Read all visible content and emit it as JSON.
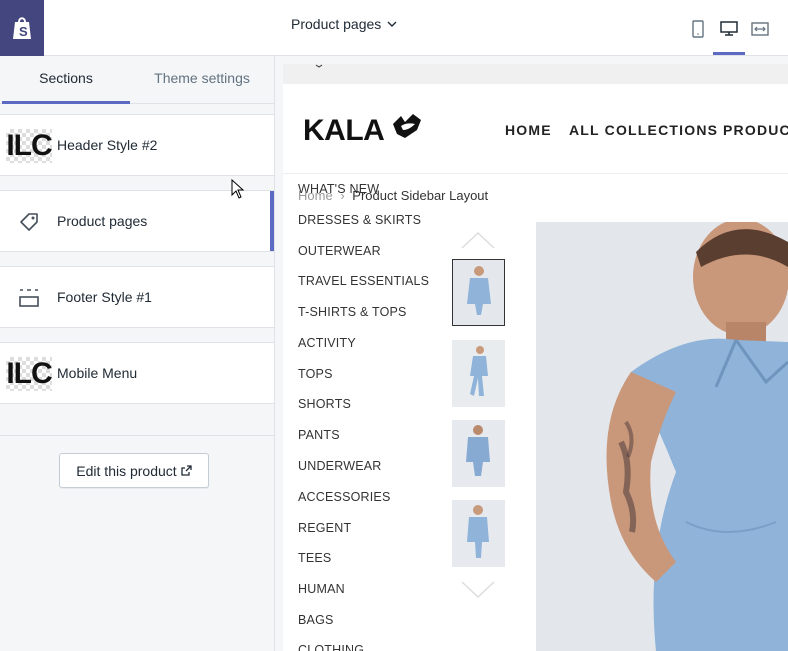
{
  "editor": {
    "tabs": [
      {
        "label": "Sections",
        "active": true
      },
      {
        "label": "Theme settings",
        "active": false
      }
    ],
    "sections": [
      {
        "label": "Header Style #2",
        "icon": "ilc-thumbnail"
      },
      {
        "label": "Product pages",
        "icon": "tag-icon",
        "selected": true
      },
      {
        "label": "Footer Style #1",
        "icon": "footer-layout-icon"
      },
      {
        "label": "Mobile Menu",
        "icon": "ilc-thumbnail"
      }
    ],
    "thumb_text": "ILC",
    "edit_button": "Edit this product"
  },
  "topbar": {
    "page_select": "Product pages",
    "devices": [
      "mobile-icon",
      "desktop-icon",
      "fullwidth-icon"
    ],
    "active_device": "desktop"
  },
  "preview": {
    "brand": "KALA",
    "nav": [
      "HOME",
      "ALL COLLECTIONS",
      "PRODUCT"
    ],
    "breadcrumb": {
      "home": "Home",
      "separator": "›",
      "current": "Product Sidebar Layout"
    },
    "categories": [
      "WHAT'S NEW",
      "DRESSES & SKIRTS",
      "OUTERWEAR",
      "TRAVEL ESSENTIALS",
      "T-SHIRTS & TOPS",
      "ACTIVITY",
      "TOPS",
      "SHORTS",
      "PANTS",
      "UNDERWEAR",
      "ACCESSORIES",
      "REGENT",
      "TEES",
      "HUMAN",
      "BAGS",
      "CLOTHING"
    ]
  },
  "colors": {
    "shopify_purple": "#43467f",
    "accent": "#5c6ac4",
    "denim": "#8fb3d9"
  }
}
